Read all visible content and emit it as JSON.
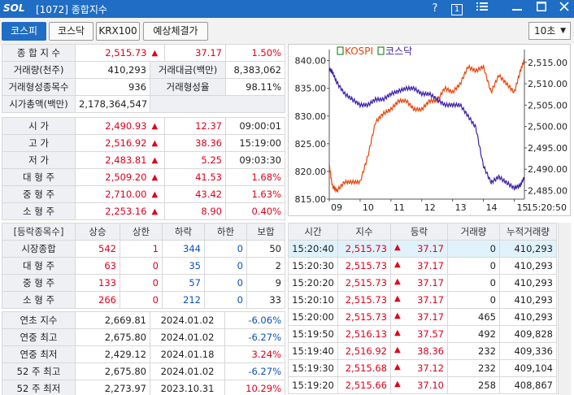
{
  "title_bar": {
    "logo": "SOL",
    "screen_number": "[1072]",
    "title": "종합지수",
    "icons": [
      "help-icon",
      "screen-number-icon",
      "menu-icon",
      "minimize-icon",
      "maximize-icon",
      "close-icon"
    ],
    "help": "?",
    "screen_no": "1"
  },
  "tabs": [
    {
      "label": "코스피",
      "active": true
    },
    {
      "label": "코스닥",
      "active": false
    },
    {
      "label": "KRX100",
      "active": false
    },
    {
      "label": "예상체결가",
      "active": false
    }
  ],
  "interval": "10초",
  "summary": {
    "index_label": "종 합 지 수",
    "index_value": "2,515.73",
    "index_change": "37.17",
    "index_rate": "1.50%",
    "volume_label": "거래량(천주)",
    "volume_value": "410,293",
    "amount_label": "거래대금(백만)",
    "amount_value": "8,383,062",
    "traded_count_label": "거래형성종목수",
    "traded_count_value": "936",
    "traded_rate_label": "거래형성율",
    "traded_rate_value": "98.11%",
    "market_cap_label": "시가총액(백만)",
    "market_cap_value": "2,178,364,547"
  },
  "ohlc": [
    {
      "label": "시    가",
      "value": "2,490.93",
      "change": "12.37",
      "time": "09:00:01"
    },
    {
      "label": "고    가",
      "value": "2,516.92",
      "change": "38.36",
      "time": "15:19:00"
    },
    {
      "label": "저    가",
      "value": "2,483.81",
      "change": "5.25",
      "time": "09:03:30"
    },
    {
      "label": "대 형 주",
      "value": "2,509.20",
      "change": "41.53",
      "time": "1.68%"
    },
    {
      "label": "중 형 주",
      "value": "2,710.00",
      "change": "43.42",
      "time": "1.63%"
    },
    {
      "label": "소 형 주",
      "value": "2,253.16",
      "change": "8.90",
      "time": "0.40%"
    }
  ],
  "updown": {
    "headers": [
      "[등락종목수]",
      "상승",
      "상한",
      "하락",
      "하한",
      "보합"
    ],
    "rows": [
      {
        "label": "시장종합",
        "rise": "542",
        "upper": "1",
        "fall": "344",
        "lower": "0",
        "flat": "50"
      },
      {
        "label": "대 형 주",
        "rise": "63",
        "upper": "0",
        "fall": "35",
        "lower": "0",
        "flat": "2"
      },
      {
        "label": "중 형 주",
        "rise": "133",
        "upper": "0",
        "fall": "57",
        "lower": "0",
        "flat": "9"
      },
      {
        "label": "소 형 주",
        "rise": "266",
        "upper": "0",
        "fall": "212",
        "lower": "0",
        "flat": "33"
      }
    ]
  },
  "yearly": [
    {
      "label": "연초  지수",
      "value": "2,669.81",
      "date": "2024.01.02",
      "rate": "-6.06%",
      "color": "blu"
    },
    {
      "label": "연중  최고",
      "value": "2,675.80",
      "date": "2024.01.02",
      "rate": "-6.27%",
      "color": "blu"
    },
    {
      "label": "연중  최저",
      "value": "2,429.12",
      "date": "2024.01.18",
      "rate": "3.24%",
      "color": "red"
    },
    {
      "label": "52 주 최고",
      "value": "2,675.80",
      "date": "2024.01.02",
      "rate": "-6.27%",
      "color": "blu"
    },
    {
      "label": "52 주 최저",
      "value": "2,273.97",
      "date": "2023.10.31",
      "rate": "10.29%",
      "color": "red"
    }
  ],
  "ticks": {
    "headers": [
      "시간",
      "지수",
      "등락",
      "거래량",
      "누적거래량"
    ],
    "rows": [
      {
        "time": "15:20:40",
        "index": "2,515.73",
        "change": "37.17",
        "vol": "0",
        "cum": "410,293"
      },
      {
        "time": "15:20:30",
        "index": "2,515.73",
        "change": "37.17",
        "vol": "0",
        "cum": "410,293"
      },
      {
        "time": "15:20:20",
        "index": "2,515.73",
        "change": "37.17",
        "vol": "0",
        "cum": "410,293"
      },
      {
        "time": "15:20:10",
        "index": "2,515.73",
        "change": "37.17",
        "vol": "0",
        "cum": "410,293"
      },
      {
        "time": "15:20:00",
        "index": "2,515.73",
        "change": "37.17",
        "vol": "465",
        "cum": "410,293"
      },
      {
        "time": "15:19:50",
        "index": "2,516.13",
        "change": "37.57",
        "vol": "492",
        "cum": "409,828"
      },
      {
        "time": "15:19:40",
        "index": "2,516.92",
        "change": "38.36",
        "vol": "232",
        "cum": "409,336"
      },
      {
        "time": "15:19:30",
        "index": "2,515.68",
        "change": "37.12",
        "vol": "232",
        "cum": "409,104"
      },
      {
        "time": "15:19:20",
        "index": "2,515.66",
        "change": "37.10",
        "vol": "258",
        "cum": "408,867"
      }
    ]
  },
  "chart_data": {
    "type": "line",
    "legend": [
      "KOSPI",
      "코스닥"
    ],
    "x_ticks": [
      "09",
      "10",
      "11",
      "12",
      "13",
      "14",
      "15",
      "15:20:50"
    ],
    "left_axis": {
      "label": "코스닥",
      "ticks": [
        "840.00",
        "835.00",
        "830.00",
        "825.00",
        "820.00",
        "815.00"
      ],
      "ylim": [
        815,
        842
      ]
    },
    "right_axis": {
      "label": "KOSPI",
      "ticks": [
        "2,515.00",
        "2,510.00",
        "2,505.00",
        "2,500.00",
        "2,495.00",
        "2,490.00",
        "2,485.00"
      ],
      "ylim": [
        2483,
        2518
      ]
    },
    "series": [
      {
        "name": "KOSPI",
        "color": "#e8460a",
        "axis": "right",
        "x": [
          9.0,
          9.1,
          9.25,
          9.5,
          9.75,
          10.0,
          10.25,
          10.5,
          10.75,
          11.0,
          11.25,
          11.5,
          11.75,
          12.0,
          12.25,
          12.5,
          12.75,
          13.0,
          13.25,
          13.5,
          13.75,
          14.0,
          14.25,
          14.5,
          14.75,
          15.0,
          15.2,
          15.33
        ],
        "y": [
          2490.9,
          2486,
          2485,
          2487,
          2487,
          2487,
          2493,
          2501,
          2503,
          2504,
          2506,
          2506,
          2504,
          2504,
          2506,
          2506,
          2509,
          2508,
          2510,
          2514,
          2513,
          2514,
          2508,
          2512,
          2510,
          2508,
          2513,
          2515.7
        ]
      },
      {
        "name": "코스닥",
        "color": "#3e1fa8",
        "axis": "left",
        "x": [
          9.0,
          9.1,
          9.25,
          9.5,
          9.75,
          10.0,
          10.25,
          10.5,
          10.75,
          11.0,
          11.25,
          11.5,
          11.75,
          12.0,
          12.25,
          12.5,
          12.75,
          13.0,
          13.25,
          13.5,
          13.75,
          14.0,
          14.25,
          14.5,
          14.75,
          15.0,
          15.2,
          15.33
        ],
        "y": [
          838.5,
          838,
          836,
          834,
          833,
          832,
          832,
          833,
          833,
          834,
          834.5,
          835,
          835,
          834,
          834,
          833,
          832,
          832,
          832,
          830,
          828,
          821,
          818,
          819,
          818,
          817,
          817.5,
          819
        ]
      }
    ]
  }
}
